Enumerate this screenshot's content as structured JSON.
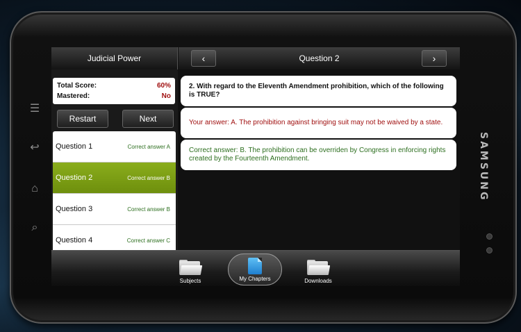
{
  "device": {
    "brand": "SAMSUNG"
  },
  "side_buttons": [
    {
      "name": "menu-icon",
      "glyph": "☰"
    },
    {
      "name": "back-icon",
      "glyph": "↩"
    },
    {
      "name": "home-icon",
      "glyph": "⌂"
    },
    {
      "name": "search-icon",
      "glyph": "⌕"
    }
  ],
  "left_panel": {
    "title": "Judicial Power",
    "score": {
      "label": "Total Score:",
      "value": "60%"
    },
    "mastered": {
      "label": "Mastered:",
      "value": "No"
    },
    "restart_label": "Restart",
    "next_label": "Next",
    "questions": [
      {
        "label": "Question 1",
        "status": "Correct answer A",
        "selected": false
      },
      {
        "label": "Question 2",
        "status": "Correct answer B",
        "selected": true
      },
      {
        "label": "Question 3",
        "status": "Correct answer B",
        "selected": false
      },
      {
        "label": "Question 4",
        "status": "Correct answer C",
        "selected": false
      }
    ]
  },
  "right_panel": {
    "title": "Question 2",
    "prev_glyph": "‹",
    "next_glyph": "›",
    "question_text": "2. With regard to the Eleventh Amendment prohibition, which of the following is TRUE?",
    "your_answer": "Your answer: A. The prohibition against bringing suit may not be waived by a state.",
    "correct_answer": "Correct answer: B. The prohibition can be overriden by Congress in enforcing rights created by the Fourteenth Amendment."
  },
  "bottom_tabs": {
    "subjects": "Subjects",
    "chapters": "My Chapters",
    "downloads": "Downloads"
  },
  "colors": {
    "selected_row": "#7d9e15",
    "wrong_answer": "#a01010",
    "correct_answer": "#2c6e1e"
  }
}
